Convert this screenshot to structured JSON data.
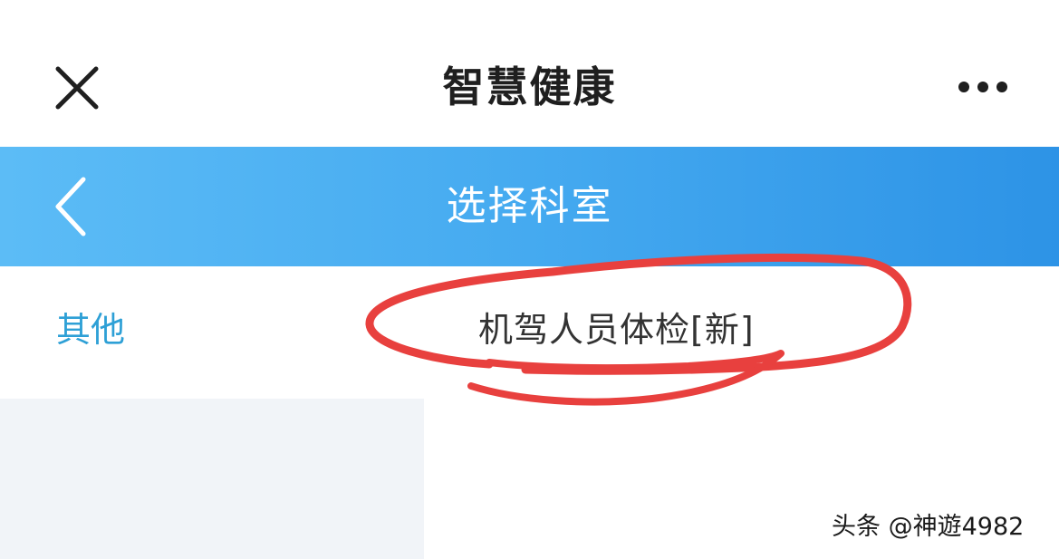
{
  "topbar": {
    "title": "智慧健康",
    "close_icon": "close-icon",
    "more_icon": "more-horizontal-icon"
  },
  "header": {
    "title": "选择科室",
    "back_icon": "chevron-left-icon",
    "gradient": [
      "#5cbcf6",
      "#2d93e6"
    ]
  },
  "sidebar": {
    "items": [
      {
        "label": "其他",
        "selected": true
      }
    ],
    "accent": "#2ea0d6"
  },
  "departments": {
    "items": [
      {
        "label": "机驾人员体检[新]"
      }
    ]
  },
  "annotation": {
    "shape": "hand-drawn red circle",
    "color": "#e8403e"
  },
  "watermark": {
    "text": "头条 @神遊4982"
  }
}
